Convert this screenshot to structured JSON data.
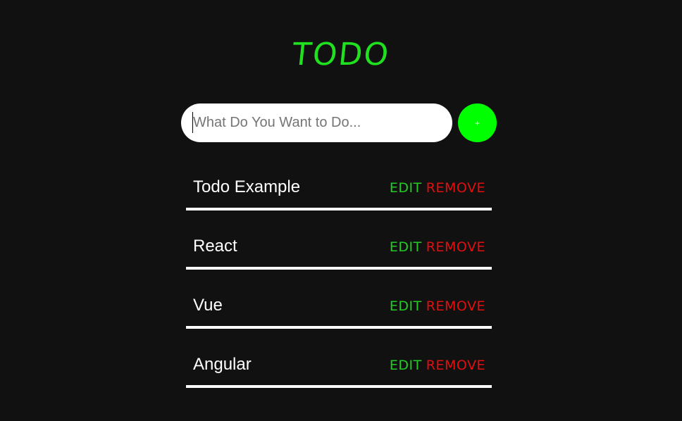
{
  "app": {
    "title": "TODO"
  },
  "form": {
    "placeholder": "What Do You Want to Do...",
    "value": "",
    "add_label": "+"
  },
  "todos": [
    {
      "text": "Todo Example",
      "edit_label": "EDIT",
      "remove_label": "REMOVE"
    },
    {
      "text": "React",
      "edit_label": "EDIT",
      "remove_label": "REMOVE"
    },
    {
      "text": "Vue",
      "edit_label": "EDIT",
      "remove_label": "REMOVE"
    },
    {
      "text": "Angular",
      "edit_label": "EDIT",
      "remove_label": "REMOVE"
    }
  ],
  "colors": {
    "background": "#111111",
    "accent": "#00ff00",
    "edit": "#22cc22",
    "remove": "#e01010",
    "text": "#ffffff"
  }
}
